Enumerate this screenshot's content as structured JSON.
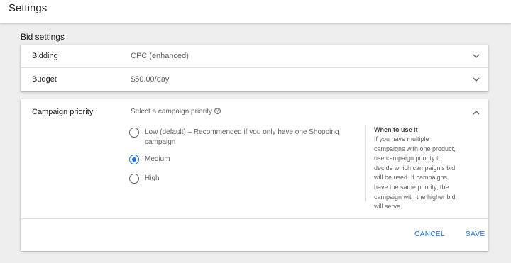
{
  "header": {
    "title": "Settings"
  },
  "bid_settings": {
    "section_title": "Bid settings",
    "rows": [
      {
        "label": "Bidding",
        "value": "CPC (enhanced)"
      },
      {
        "label": "Budget",
        "value": "$50.00/day"
      }
    ]
  },
  "campaign_priority": {
    "label": "Campaign priority",
    "hint": "Select a campaign priority",
    "options": [
      {
        "label": "Low (default) – Recommended if you only have one Shopping campaign",
        "selected": false
      },
      {
        "label": "Medium",
        "selected": true
      },
      {
        "label": "High",
        "selected": false
      }
    ],
    "help": {
      "title": "When to use it",
      "body": "If you have multiple campaigns with one product, use campaign priority to decide which campaign's bid will be used. If campaigns have the same priority, the campaign with the higher bid will serve."
    },
    "actions": {
      "cancel_label": "CANCEL",
      "save_label": "SAVE"
    }
  },
  "colors": {
    "accent": "#1a73e8",
    "background": "#eeeeee",
    "card": "#ffffff",
    "secondary_text": "#5f6368"
  },
  "icons": {
    "expand": "chevron-down-icon",
    "collapse": "chevron-up-icon",
    "help": "help-circle-icon"
  }
}
